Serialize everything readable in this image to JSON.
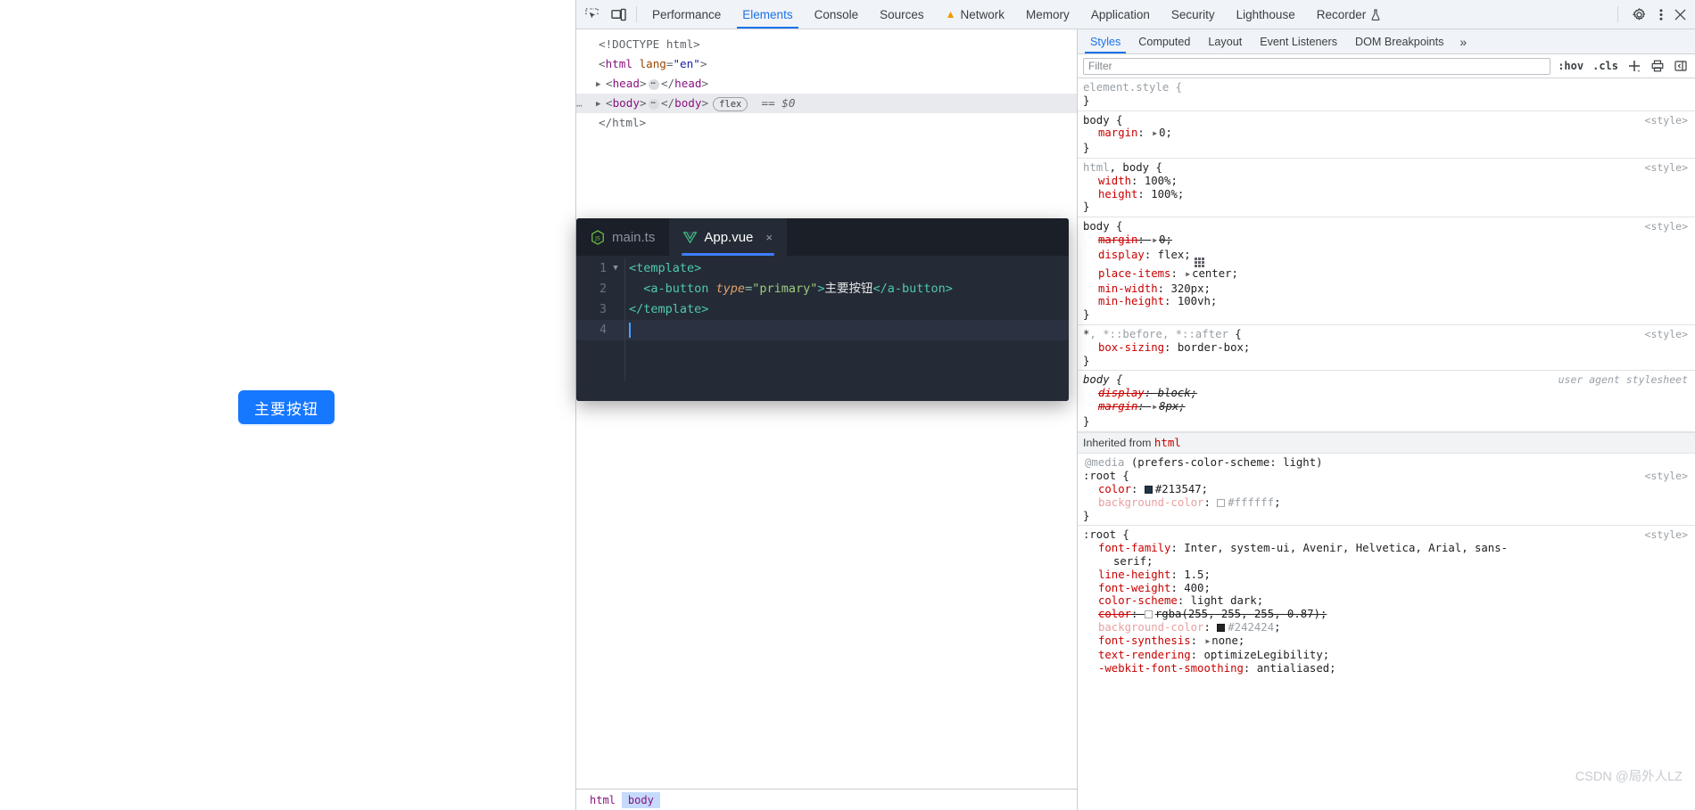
{
  "page": {
    "button_label": "主要按钮",
    "button_color": "#1677ff"
  },
  "devtools": {
    "toolbar_icons": [
      "inspect-element-icon",
      "device-toolbar-icon"
    ],
    "tabs": [
      {
        "label": "Performance",
        "active": false,
        "warning": false
      },
      {
        "label": "Elements",
        "active": true,
        "warning": false
      },
      {
        "label": "Console",
        "active": false,
        "warning": false
      },
      {
        "label": "Sources",
        "active": false,
        "warning": false
      },
      {
        "label": "Network",
        "active": false,
        "warning": true
      },
      {
        "label": "Memory",
        "active": false,
        "warning": false
      },
      {
        "label": "Application",
        "active": false,
        "warning": false
      },
      {
        "label": "Security",
        "active": false,
        "warning": false
      },
      {
        "label": "Lighthouse",
        "active": false,
        "warning": false
      },
      {
        "label": "Recorder",
        "active": false,
        "warning": false,
        "flask": true
      }
    ],
    "right_icons": [
      "settings-gear-icon",
      "more-vertical-icon",
      "close-icon"
    ],
    "dom": {
      "lines": [
        {
          "text": "<!DOCTYPE html>"
        },
        {
          "text": "<html lang=\"en\">"
        },
        {
          "text": "<head> … </head>"
        },
        {
          "text": "<body> … </body> flex == $0",
          "selected": true
        },
        {
          "text": "</html>"
        }
      ],
      "doctype": "<!DOCTYPE html>",
      "html_open_tag": "html",
      "html_attr_name": "lang",
      "html_attr_value": "\"en\"",
      "head_tag": "head",
      "body_tag": "body",
      "flex_badge": "flex",
      "selected_marker": "== $0",
      "html_close": "</html>"
    },
    "breadcrumb": [
      "html",
      "body"
    ]
  },
  "styles_panel": {
    "tabs": [
      {
        "label": "Styles",
        "active": true
      },
      {
        "label": "Computed",
        "active": false
      },
      {
        "label": "Layout",
        "active": false
      },
      {
        "label": "Event Listeners",
        "active": false
      },
      {
        "label": "DOM Breakpoints",
        "active": false
      }
    ],
    "more_chevron": "»",
    "filter_placeholder": "Filter",
    "filter_value": "",
    "toolbar": {
      "hov": ":hov",
      "cls": ".cls",
      "new_rule_icon": "plus-icon",
      "print_icon": "print-media-icon",
      "sidebar_icon": "toggle-sidebar-icon"
    },
    "rules": [
      {
        "selector": "element.style",
        "selector_style": "dim",
        "origin": "",
        "declarations": []
      },
      {
        "selector": "body",
        "selector_style": "normal",
        "origin": "<style>",
        "declarations": [
          {
            "prop": "margin",
            "value": "0",
            "triangle": true,
            "struck": false
          }
        ]
      },
      {
        "selector": "html, body",
        "selector_style": "partial-dim",
        "origin": "<style>",
        "declarations": [
          {
            "prop": "width",
            "value": "100%",
            "triangle": false,
            "struck": false
          },
          {
            "prop": "height",
            "value": "100%",
            "triangle": false,
            "struck": false
          }
        ]
      },
      {
        "selector": "body",
        "selector_style": "normal",
        "origin": "<style>",
        "declarations": [
          {
            "prop": "margin",
            "value": "0",
            "triangle": true,
            "struck": true
          },
          {
            "prop": "display",
            "value": "flex",
            "triangle": false,
            "struck": false,
            "flexicon": true
          },
          {
            "prop": "place-items",
            "value": "center",
            "triangle": true,
            "struck": false
          },
          {
            "prop": "min-width",
            "value": "320px",
            "triangle": false,
            "struck": false
          },
          {
            "prop": "min-height",
            "value": "100vh",
            "triangle": false,
            "struck": false
          }
        ]
      },
      {
        "selector": "*, *::before, *::after",
        "selector_style": "star",
        "origin": "<style>",
        "declarations": [
          {
            "prop": "box-sizing",
            "value": "border-box",
            "triangle": false,
            "struck": false
          }
        ]
      },
      {
        "selector": "body",
        "selector_style": "ua",
        "origin": "user agent stylesheet",
        "declarations": [
          {
            "prop": "display",
            "value": "block",
            "triangle": false,
            "struck": true
          },
          {
            "prop": "margin",
            "value": "8px",
            "triangle": true,
            "struck": true
          }
        ]
      }
    ],
    "inherited_label": "Inherited from",
    "inherited_from": "html",
    "media_query": "@media (prefers-color-scheme: light)",
    "inherited_rules": [
      {
        "selector": ":root",
        "origin": "<style>",
        "declarations": [
          {
            "prop": "color",
            "value": "#213547",
            "swatch": "#213547",
            "struck": false
          },
          {
            "prop": "background-color",
            "value": "#ffffff",
            "swatch": "#ffffff",
            "struck": false,
            "prop_dim": true
          }
        ]
      },
      {
        "selector": ":root",
        "origin": "<style>",
        "declarations": [
          {
            "prop": "font-family",
            "value": "Inter, system-ui, Avenir, Helvetica, Arial, sans-",
            "cont": "serif;",
            "struck": false
          },
          {
            "prop": "line-height",
            "value": "1.5",
            "struck": false
          },
          {
            "prop": "font-weight",
            "value": "400",
            "struck": false
          },
          {
            "prop": "color-scheme",
            "value": "light dark",
            "struck": false
          },
          {
            "prop": "color",
            "value": "rgba(255, 255, 255, 0.87)",
            "swatch": "rgba(255,255,255,0.87)",
            "struck": true
          },
          {
            "prop": "background-color",
            "value": "#242424",
            "swatch": "#242424",
            "struck": false,
            "prop_dim": true
          },
          {
            "prop": "font-synthesis",
            "value": "none",
            "triangle": true,
            "struck": false
          },
          {
            "prop": "text-rendering",
            "value": "optimizeLegibility",
            "struck": false
          },
          {
            "prop": "-webkit-font-smoothing",
            "value": "antialiased;",
            "struck": false
          }
        ]
      }
    ]
  },
  "editor": {
    "tabs": [
      {
        "label": "main.ts",
        "icon": "nodejs-icon",
        "active": false,
        "closable": false
      },
      {
        "label": "App.vue",
        "icon": "vue-icon",
        "active": true,
        "closable": true,
        "close_label": "×"
      }
    ],
    "lines": [
      {
        "number": "1",
        "foldable": true,
        "tokens": [
          {
            "t": "<template>",
            "c": "tag"
          }
        ]
      },
      {
        "number": "2",
        "foldable": false,
        "tokens": [
          {
            "t": "  <a-button ",
            "c": "tag"
          },
          {
            "t": "type",
            "c": "attr"
          },
          {
            "t": "=",
            "c": "punct"
          },
          {
            "t": "\"primary\"",
            "c": "str"
          },
          {
            "t": ">",
            "c": "tag"
          },
          {
            "t": "主要按钮",
            "c": "text"
          },
          {
            "t": "</a-button>",
            "c": "tag"
          }
        ]
      },
      {
        "number": "3",
        "foldable": false,
        "tokens": [
          {
            "t": "</template>",
            "c": "tag"
          }
        ]
      },
      {
        "number": "4",
        "foldable": false,
        "cursor": true,
        "tokens": []
      }
    ]
  },
  "watermark": "CSDN @局外人LZ"
}
